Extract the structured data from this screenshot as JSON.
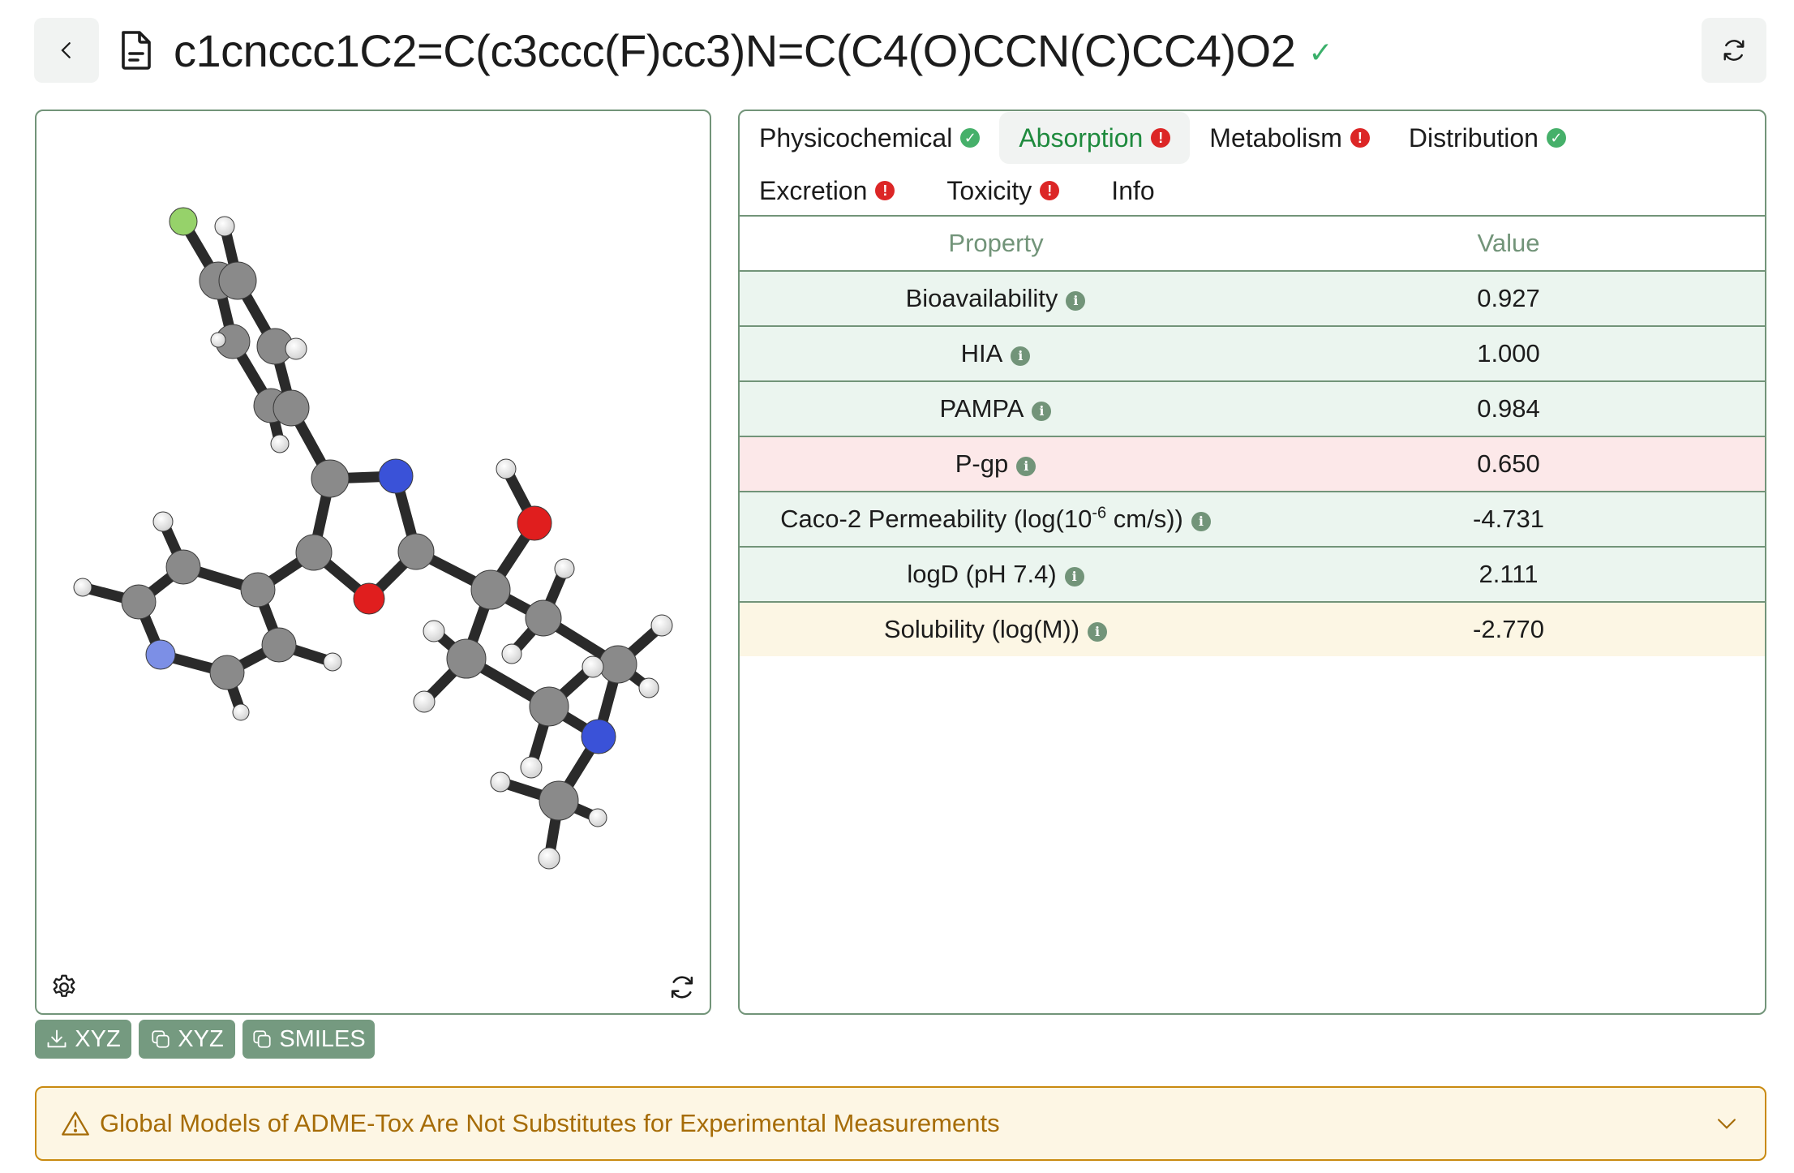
{
  "header": {
    "title": "c1cnccc1C2=C(c3ccc(F)cc3)N=C(C4(O)CCN(C)CC4)O2",
    "valid_icon": "check-icon",
    "back_icon": "chevron-left-icon",
    "file_icon": "document-icon",
    "refresh_icon": "refresh-icon"
  },
  "viewer": {
    "settings_icon": "gear-icon",
    "reset_icon": "refresh-icon",
    "atom_colors": {
      "C": "#8a8a8a",
      "H": "#f2f2f2",
      "N": "#3a52d8",
      "O": "#e01e1e",
      "F": "#96d26a",
      "N_far": "#7c8fe6"
    }
  },
  "actions": {
    "download_xyz": "XYZ",
    "copy_xyz": "XYZ",
    "copy_smiles": "SMILES"
  },
  "tabs": [
    {
      "label": "Physicochemical",
      "status": "ok",
      "active": false
    },
    {
      "label": "Absorption",
      "status": "warn",
      "active": true
    },
    {
      "label": "Metabolism",
      "status": "warn",
      "active": false
    },
    {
      "label": "Distribution",
      "status": "ok",
      "active": false
    },
    {
      "label": "Excretion",
      "status": "warn",
      "active": false
    },
    {
      "label": "Toxicity",
      "status": "warn",
      "active": false
    },
    {
      "label": "Info",
      "status": "none",
      "active": false
    }
  ],
  "table": {
    "headers": {
      "property": "Property",
      "value": "Value"
    },
    "rows": [
      {
        "property": "Bioavailability",
        "value": "0.927",
        "level": "good"
      },
      {
        "property": "HIA",
        "value": "1.000",
        "level": "good"
      },
      {
        "property": "PAMPA",
        "value": "0.984",
        "level": "good"
      },
      {
        "property": "P-gp",
        "value": "0.650",
        "level": "bad"
      },
      {
        "property_pre": "Caco-2 Permeability (log(10",
        "property_sup": "-6",
        "property_post": " cm/s))",
        "value": "-4.731",
        "level": "good"
      },
      {
        "property": "logD (pH 7.4)",
        "value": "2.111",
        "level": "good"
      },
      {
        "property": "Solubility (log(M))",
        "value": "-2.770",
        "level": "mid"
      }
    ]
  },
  "disclaimer": {
    "text": "Global Models of ADME-Tox Are Not Substitutes for Experimental Measurements",
    "icon": "warning-triangle-icon",
    "expand_icon": "chevron-down-icon"
  },
  "colors": {
    "accent": "#729479",
    "button": "#759a80",
    "ok": "#46b06a",
    "warn": "#dc2626",
    "active_tab_text": "#1f8a3e",
    "disclaimer_text": "#a66c07",
    "disclaimer_border": "#c98a10"
  }
}
